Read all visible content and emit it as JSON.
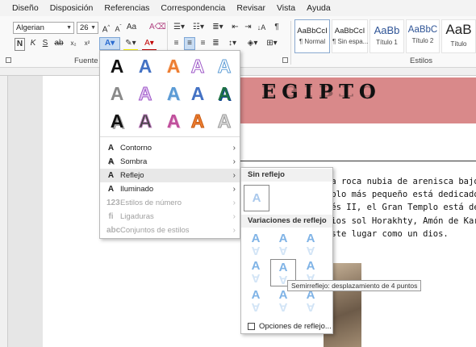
{
  "menubar": {
    "tabs": [
      "Diseño",
      "Disposición",
      "Referencias",
      "Correspondencia",
      "Revisar",
      "Vista",
      "Ayuda"
    ]
  },
  "ribbon": {
    "font_name": "Algerian",
    "font_size": "26",
    "group_fuente": "Fuente",
    "group_estilos": "Estilos",
    "styles": [
      {
        "sample": "AaBbCcI",
        "name": "¶ Normal"
      },
      {
        "sample": "AaBbCcI",
        "name": "¶ Sin espa..."
      },
      {
        "sample": "AaBb",
        "name": "Título 1"
      },
      {
        "sample": "AaBbC",
        "name": "Título 2"
      },
      {
        "sample": "AaB",
        "name": "Título"
      }
    ]
  },
  "document": {
    "title": "EGIPTO",
    "lines": [
      "la roca nubia de arenisca bajo las",
      "mplo más pequeño está dedicado a",
      "sés II, el Gran Templo está dedic",
      "dios sol Horakhty, Amón de Karna",
      "este lugar como un dios."
    ]
  },
  "effects_menu": {
    "items": [
      {
        "label": "Contorno",
        "enabled": true
      },
      {
        "label": "Sombra",
        "enabled": true
      },
      {
        "label": "Reflejo",
        "enabled": true
      },
      {
        "label": "Iluminado",
        "enabled": true
      },
      {
        "label": "Estilos de número",
        "enabled": false
      },
      {
        "label": "Ligaduras",
        "enabled": false
      },
      {
        "label": "Conjuntos de estilos",
        "enabled": false
      }
    ]
  },
  "reflection_menu": {
    "no_reflection_header": "Sin reflejo",
    "variations_header": "Variaciones de reflejo",
    "options_label": "Opciones de reflejo...",
    "tooltip": "Semirreflejo: desplazamiento de 4 puntos"
  },
  "colors": {
    "banner": "#d9898a",
    "accent_blue": "#4472c4",
    "reflection_blue": "#7fb3e6"
  }
}
